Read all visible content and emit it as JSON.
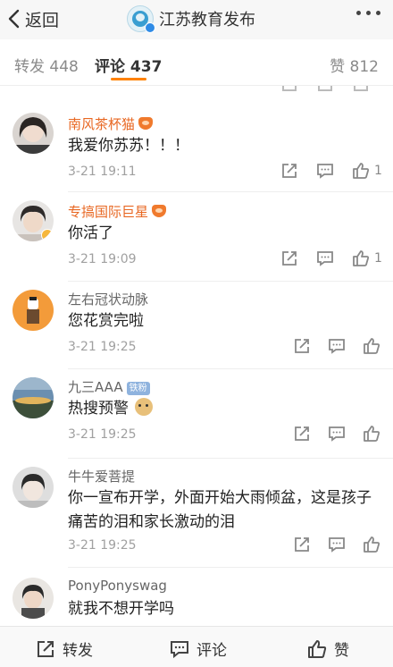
{
  "header": {
    "back_label": "返回",
    "title": "江苏教育发布",
    "more_icon": "more-dots-icon"
  },
  "tabs": {
    "repost": "转发 448",
    "comment": "评论 437",
    "like": "赞 812"
  },
  "comments": [
    {
      "name": "南风茶杯猫",
      "text": "我爱你苏苏！！！",
      "time": "3-21 19:11",
      "likes": "1",
      "vip": true
    },
    {
      "name": "专搞国际巨星",
      "text": "你活了",
      "time": "3-21 19:09",
      "likes": "1",
      "vip": true
    },
    {
      "name": "左右冠状动脉",
      "text": "您花赏完啦",
      "time": "3-21 19:25",
      "likes": "",
      "vip": false
    },
    {
      "name": "九三AAA",
      "badge": "铁粉",
      "text": "热搜预警",
      "time": "3-21 19:25",
      "likes": "",
      "vip": false
    },
    {
      "name": "牛牛爱菩提",
      "text": "你一宣布开学，外面开始大雨倾盆，这是孩子痛苦的泪和家长激动的泪",
      "time": "3-21 19:25",
      "likes": "",
      "vip": false
    },
    {
      "name": "PonyPonyswag",
      "text": "就我不想开学吗",
      "time": "",
      "likes": "",
      "vip": false
    }
  ],
  "bottom_bar": {
    "repost": "转发",
    "comment": "评论",
    "like": "赞"
  },
  "colors": {
    "accent": "#ff8200",
    "vip_name": "#e86722",
    "fan_badge": "#8fb3de"
  }
}
